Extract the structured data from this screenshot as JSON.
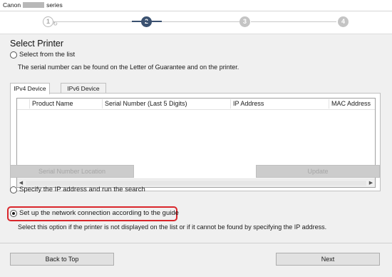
{
  "window": {
    "title_prefix": "Canon",
    "title_suffix": "series"
  },
  "steps": [
    {
      "number": "1",
      "state": "done"
    },
    {
      "number": "2",
      "state": "current"
    },
    {
      "number": "3",
      "state": "todo"
    },
    {
      "number": "4",
      "state": "todo"
    }
  ],
  "heading": "Select Printer",
  "option_list": {
    "label": "Select from the list",
    "selected": false,
    "note": "The serial number can be found on the Letter of Guarantee and on the printer."
  },
  "tabs": [
    {
      "label": "IPv4 Device",
      "active": true
    },
    {
      "label": "IPv6 Device",
      "active": false
    }
  ],
  "table": {
    "columns": [
      "",
      "Product Name",
      "Serial Number (Last 5 Digits)",
      "IP Address",
      "MAC Address"
    ],
    "rows": []
  },
  "buttons": {
    "serial_location": "Serial Number Location",
    "update": "Update",
    "back": "Back to Top",
    "next": "Next"
  },
  "option_ip": {
    "label": "Specify the IP address and run the search",
    "selected": false
  },
  "option_guide": {
    "label": "Set up the network connection according to the guide",
    "selected": true,
    "note": "Select this option if the printer is not displayed on the list or if it cannot be found by specifying the IP address."
  },
  "colors": {
    "current_step": "#3a5170",
    "highlight_border": "#d9262b"
  }
}
